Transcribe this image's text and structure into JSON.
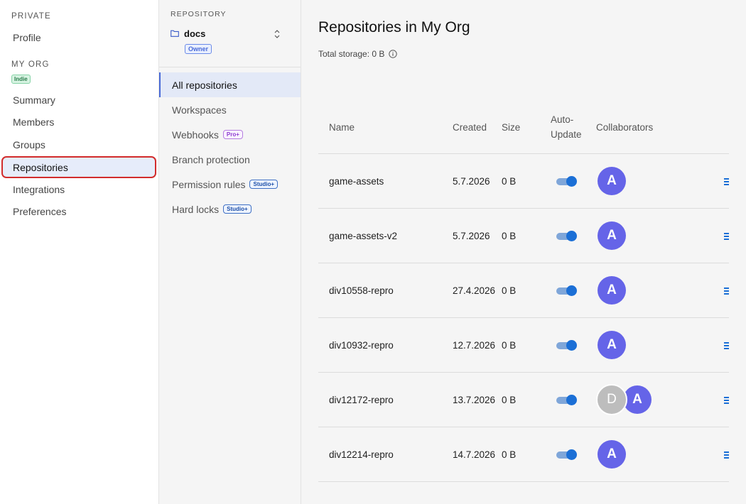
{
  "sidebar": {
    "private_label": "PRIVATE",
    "profile": "Profile",
    "org_label": "MY ORG",
    "org_badge": "Indie",
    "items": [
      "Summary",
      "Members",
      "Groups",
      "Repositories",
      "Integrations",
      "Preferences"
    ],
    "active_item": "Repositories"
  },
  "repo_panel": {
    "section_label": "REPOSITORY",
    "repo_name": "docs",
    "repo_icon": "folder-icon",
    "role_badge": "Owner",
    "items": [
      {
        "label": "All repositories",
        "badge": ""
      },
      {
        "label": "Workspaces",
        "badge": ""
      },
      {
        "label": "Webhooks",
        "badge": "Pro+"
      },
      {
        "label": "Branch protection",
        "badge": ""
      },
      {
        "label": "Permission rules",
        "badge": "Studio+"
      },
      {
        "label": "Hard locks",
        "badge": "Studio+"
      }
    ],
    "active_item": "All repositories"
  },
  "main": {
    "title": "Repositories in My Org",
    "storage_text": "Total storage: 0 B",
    "table": {
      "headers": {
        "name": "Name",
        "created": "Created",
        "size": "Size",
        "auto_update_1": "Auto-",
        "auto_update_2": "Update",
        "collaborators": "Collaborators"
      },
      "rows": [
        {
          "name": "game-assets",
          "created": "5.7.2026",
          "size": "0 B",
          "auto_update": true,
          "collaborators": [
            "A"
          ]
        },
        {
          "name": "game-assets-v2",
          "created": "5.7.2026",
          "size": "0 B",
          "auto_update": true,
          "collaborators": [
            "A"
          ]
        },
        {
          "name": "div10558-repro",
          "created": "27.4.2026",
          "size": "0 B",
          "auto_update": true,
          "collaborators": [
            "A"
          ]
        },
        {
          "name": "div10932-repro",
          "created": "12.7.2026",
          "size": "0 B",
          "auto_update": true,
          "collaborators": [
            "A"
          ]
        },
        {
          "name": "div12172-repro",
          "created": "13.7.2026",
          "size": "0 B",
          "auto_update": true,
          "collaborators": [
            "D",
            "A"
          ]
        },
        {
          "name": "div12214-repro",
          "created": "14.7.2026",
          "size": "0 B",
          "auto_update": true,
          "collaborators": [
            "A"
          ]
        }
      ]
    }
  },
  "colors": {
    "accent": "#1b6fd6",
    "avatar_primary": "#6564e8",
    "avatar_secondary": "#bdbdbd",
    "highlight_border": "#d22c2c"
  }
}
